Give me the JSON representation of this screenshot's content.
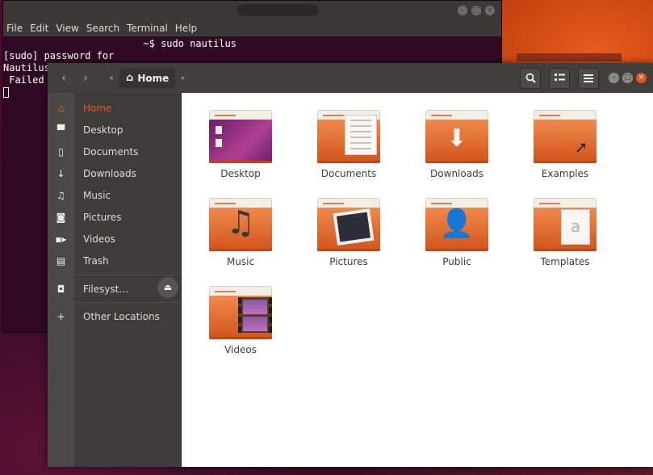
{
  "terminal": {
    "menu": [
      "File",
      "Edit",
      "View",
      "Search",
      "Terminal",
      "Help"
    ],
    "lines": [
      "                        ~$ sudo nautilus",
      "[sudo] password for",
      "Nautilus",
      " Failed"
    ],
    "controls": [
      "minimize",
      "maximize",
      "close"
    ]
  },
  "nautilus": {
    "breadcrumb": {
      "label": "Home",
      "icon": "home-icon"
    },
    "toolbar": {
      "search_icon": "search-icon",
      "view_icon": "list-view-icon",
      "menu_icon": "hamburger-menu-icon"
    },
    "sidebar": {
      "items": [
        {
          "label": "Home",
          "icon": "home-icon",
          "active": true
        },
        {
          "label": "Desktop",
          "icon": "folder-icon"
        },
        {
          "label": "Documents",
          "icon": "document-icon"
        },
        {
          "label": "Downloads",
          "icon": "download-icon"
        },
        {
          "label": "Music",
          "icon": "music-icon"
        },
        {
          "label": "Pictures",
          "icon": "camera-icon"
        },
        {
          "label": "Videos",
          "icon": "video-icon"
        },
        {
          "label": "Trash",
          "icon": "trash-icon"
        },
        {
          "label": "Filesyst…",
          "icon": "drive-icon"
        },
        {
          "label": "Other Locations",
          "icon": "plus-icon"
        }
      ]
    },
    "files": [
      {
        "label": "Desktop"
      },
      {
        "label": "Documents"
      },
      {
        "label": "Downloads"
      },
      {
        "label": "Examples"
      },
      {
        "label": "Music"
      },
      {
        "label": "Pictures"
      },
      {
        "label": "Public"
      },
      {
        "label": "Templates"
      },
      {
        "label": "Videos"
      }
    ]
  },
  "colors": {
    "accent": "#e95420",
    "terminal_bg": "#300a24",
    "headerbar": "#403f3c",
    "sidebar": "#3d3c3a"
  }
}
